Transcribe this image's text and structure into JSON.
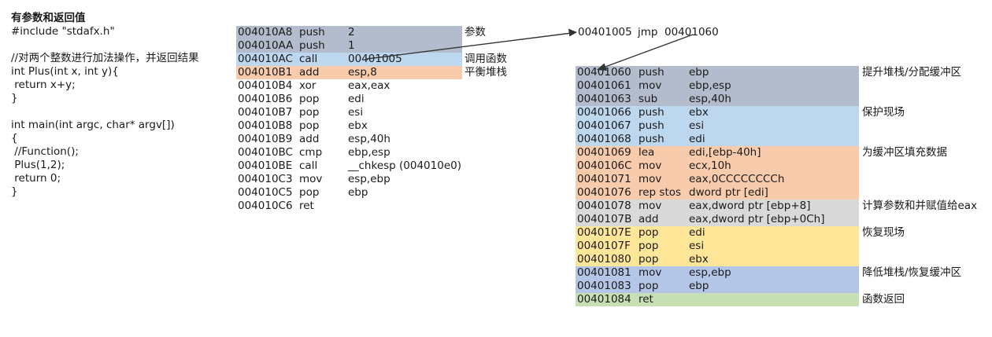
{
  "colors": {
    "gray_blue": "#b3bccc",
    "light_blue": "#bdd7ee",
    "peach": "#f8cbad",
    "gray": "#d9d9d9",
    "yellow": "#ffe699",
    "periwinkle": "#b4c6e7",
    "green": "#c6e0b4",
    "arrow": "#333333"
  },
  "source": {
    "title": "有参数和返回值",
    "lines": [
      "#include \"stdafx.h\"",
      "",
      "//对两个整数进行加法操作，并返回结果",
      "int Plus(int x, int y){",
      " return x+y;",
      "}",
      "",
      "int main(int argc, char* argv[])",
      "{",
      " //Function();",
      " Plus(1,2);",
      " return 0;",
      "}"
    ]
  },
  "caller": {
    "rows": [
      {
        "addr": "004010A8",
        "op": "push",
        "arg": "2",
        "color": "gray_blue"
      },
      {
        "addr": "004010AA",
        "op": "push",
        "arg": "1",
        "color": "gray_blue"
      },
      {
        "addr": "004010AC",
        "op": "call",
        "arg": "00401005",
        "color": "light_blue"
      },
      {
        "addr": "004010B1",
        "op": "add",
        "arg": "esp,8",
        "color": "peach"
      },
      {
        "addr": "004010B4",
        "op": "xor",
        "arg": "eax,eax",
        "color": ""
      },
      {
        "addr": "004010B6",
        "op": "pop",
        "arg": "edi",
        "color": ""
      },
      {
        "addr": "004010B7",
        "op": "pop",
        "arg": "esi",
        "color": ""
      },
      {
        "addr": "004010B8",
        "op": "pop",
        "arg": "ebx",
        "color": ""
      },
      {
        "addr": "004010B9",
        "op": "add",
        "arg": "esp,40h",
        "color": ""
      },
      {
        "addr": "004010BC",
        "op": "cmp",
        "arg": "ebp,esp",
        "color": ""
      },
      {
        "addr": "004010BE",
        "op": "call",
        "arg": "__chkesp (004010e0)",
        "color": ""
      },
      {
        "addr": "004010C3",
        "op": "mov",
        "arg": "esp,ebp",
        "color": ""
      },
      {
        "addr": "004010C5",
        "op": "pop",
        "arg": "ebp",
        "color": ""
      },
      {
        "addr": "004010C6",
        "op": "ret",
        "arg": "",
        "color": ""
      }
    ],
    "labels": [
      "参数",
      "调用函数",
      "平衡堆栈"
    ]
  },
  "jmp": {
    "addr": "00401005",
    "op": "jmp",
    "arg": "00401060"
  },
  "callee": {
    "rows": [
      {
        "addr": "00401060",
        "op": "push",
        "arg": "ebp",
        "color": "gray_blue"
      },
      {
        "addr": "00401061",
        "op": "mov",
        "arg": "ebp,esp",
        "color": "gray_blue"
      },
      {
        "addr": "00401063",
        "op": "sub",
        "arg": "esp,40h",
        "color": "gray_blue"
      },
      {
        "addr": "00401066",
        "op": "push",
        "arg": "ebx",
        "color": "light_blue"
      },
      {
        "addr": "00401067",
        "op": "push",
        "arg": "esi",
        "color": "light_blue"
      },
      {
        "addr": "00401068",
        "op": "push",
        "arg": "edi",
        "color": "light_blue"
      },
      {
        "addr": "00401069",
        "op": "lea",
        "arg": "edi,[ebp-40h]",
        "color": "peach"
      },
      {
        "addr": "0040106C",
        "op": "mov",
        "arg": "ecx,10h",
        "color": "peach"
      },
      {
        "addr": "00401071",
        "op": "mov",
        "arg": "eax,0CCCCCCCCh",
        "color": "peach"
      },
      {
        "addr": "00401076",
        "op": "rep stos",
        "arg": "dword ptr [edi]",
        "color": "peach"
      },
      {
        "addr": "00401078",
        "op": "mov",
        "arg": "eax,dword ptr [ebp+8]",
        "color": "gray"
      },
      {
        "addr": "0040107B",
        "op": "add",
        "arg": "eax,dword ptr [ebp+0Ch]",
        "color": "gray"
      },
      {
        "addr": "0040107E",
        "op": "pop",
        "arg": "edi",
        "color": "yellow"
      },
      {
        "addr": "0040107F",
        "op": "pop",
        "arg": "esi",
        "color": "yellow"
      },
      {
        "addr": "00401080",
        "op": "pop",
        "arg": "ebx",
        "color": "yellow"
      },
      {
        "addr": "00401081",
        "op": "mov",
        "arg": "esp,ebp",
        "color": "periwinkle"
      },
      {
        "addr": "00401083",
        "op": "pop",
        "arg": "ebp",
        "color": "periwinkle"
      },
      {
        "addr": "00401084",
        "op": "ret",
        "arg": "",
        "color": "green"
      }
    ],
    "labels": [
      "提升堆栈/分配缓冲区",
      "保护现场",
      "为缓冲区填充数据",
      "计算参数和并赋值给eax",
      "恢复现场",
      "降低堆栈/恢复缓冲区",
      "函数返回"
    ]
  }
}
